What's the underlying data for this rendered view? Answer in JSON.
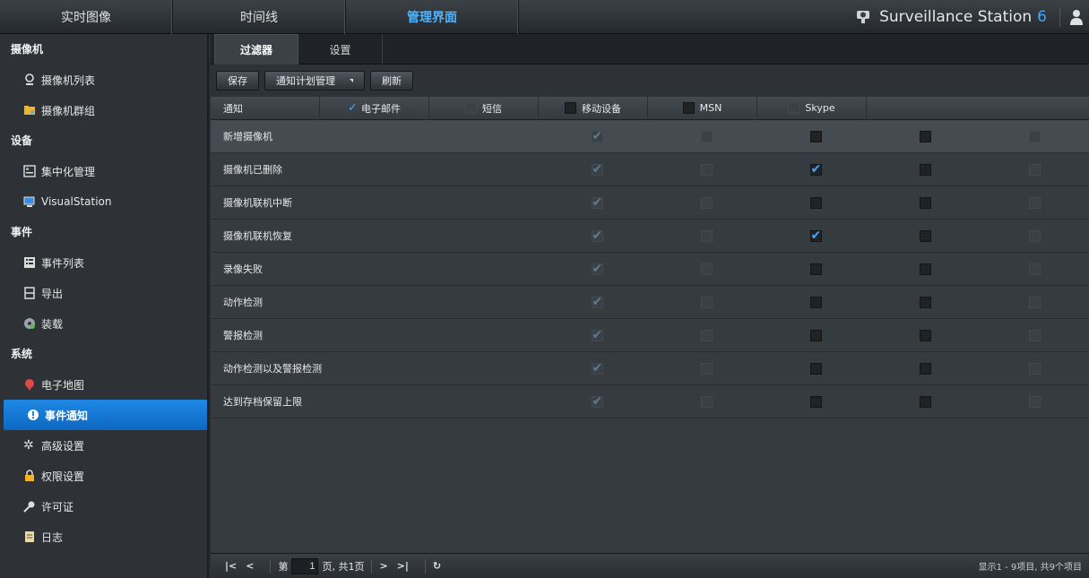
{
  "topnav": {
    "items": [
      "实时图像",
      "时间线",
      "管理界面"
    ],
    "active_index": 2,
    "brand_title": "Surveillance Station",
    "brand_version": "6"
  },
  "sidebar": {
    "sections": [
      {
        "label": "摄像机",
        "items": [
          {
            "label": "摄像机列表",
            "icon": "camera-icon"
          },
          {
            "label": "摄像机群组",
            "icon": "folder-icon"
          }
        ]
      },
      {
        "label": "设备",
        "items": [
          {
            "label": "集中化管理",
            "icon": "server-icon"
          },
          {
            "label": "VisualStation",
            "icon": "monitor-icon"
          }
        ]
      },
      {
        "label": "事件",
        "items": [
          {
            "label": "事件列表",
            "icon": "list-icon"
          },
          {
            "label": "导出",
            "icon": "export-icon"
          },
          {
            "label": "装载",
            "icon": "mount-icon"
          }
        ]
      },
      {
        "label": "系统",
        "items": [
          {
            "label": "电子地图",
            "icon": "map-pin-icon"
          },
          {
            "label": "事件通知",
            "icon": "notification-icon"
          },
          {
            "label": "高级设置",
            "icon": "gear-icon"
          },
          {
            "label": "权限设置",
            "icon": "lock-icon"
          },
          {
            "label": "许可证",
            "icon": "key-icon"
          },
          {
            "label": "日志",
            "icon": "log-icon"
          }
        ]
      }
    ],
    "active": "事件通知"
  },
  "tabs": [
    "过滤器",
    "设置"
  ],
  "toolbar": {
    "save": "保存",
    "schedule": "通知计划管理",
    "refresh": "刷新"
  },
  "table": {
    "headers": [
      "通知",
      "电子邮件",
      "短信",
      "移动设备",
      "MSN",
      "Skype"
    ],
    "rows": [
      {
        "label": "新增摄像机",
        "checks": [
          true,
          false,
          false,
          false,
          false
        ]
      },
      {
        "label": "摄像机已删除",
        "checks": [
          true,
          false,
          true,
          false,
          false
        ]
      },
      {
        "label": "摄像机联机中断",
        "checks": [
          true,
          false,
          false,
          false,
          false
        ]
      },
      {
        "label": "摄像机联机恢复",
        "checks": [
          true,
          false,
          true,
          false,
          false
        ]
      },
      {
        "label": "录像失败",
        "checks": [
          true,
          false,
          false,
          false,
          false
        ]
      },
      {
        "label": "动作检测",
        "checks": [
          true,
          false,
          false,
          false,
          false
        ]
      },
      {
        "label": "警报检测",
        "checks": [
          true,
          false,
          false,
          false,
          false
        ]
      },
      {
        "label": "动作检测以及警报检测",
        "checks": [
          true,
          false,
          false,
          false,
          false
        ]
      },
      {
        "label": "达到存档保留上限",
        "checks": [
          true,
          false,
          false,
          false,
          false
        ]
      }
    ],
    "selected_row": 0
  },
  "footer": {
    "page_prefix": "第",
    "page_value": "1",
    "page_suffix": "页, 共1页",
    "status": "显示1 - 9项目, 共9个项目"
  },
  "colors": {
    "accent": "#1e88e5",
    "check": "#44a6ff"
  }
}
